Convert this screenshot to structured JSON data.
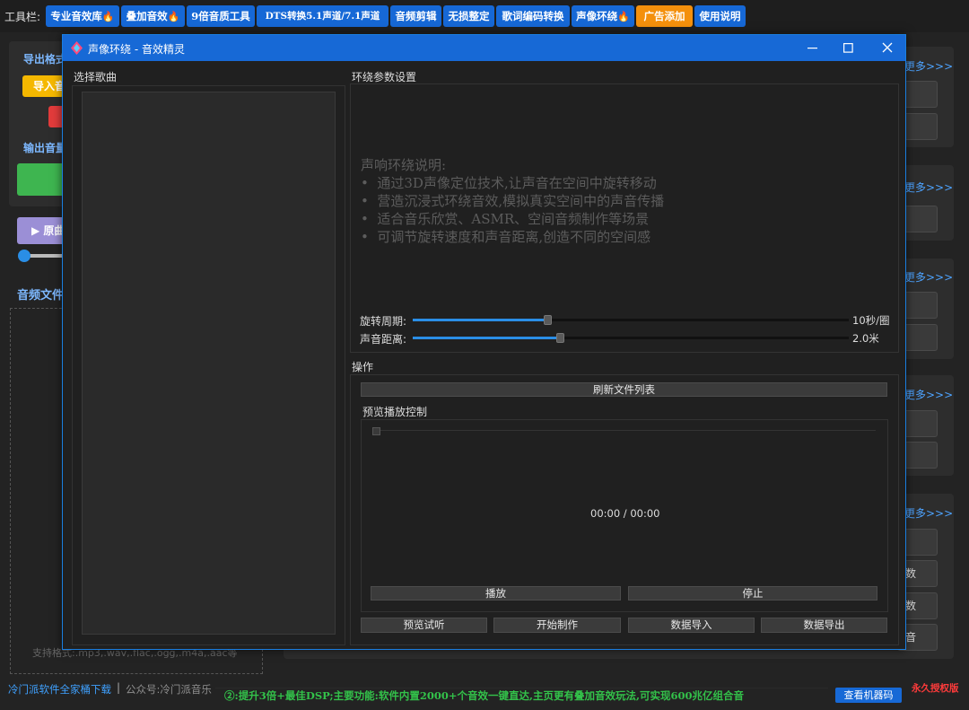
{
  "toolbar": {
    "label": "工具栏:",
    "buttons": [
      {
        "label": "专业音效库",
        "fire": true,
        "style": "blue"
      },
      {
        "label": "叠加音效",
        "fire": true,
        "style": "blue"
      },
      {
        "label": "9倍音质工具",
        "fire": false,
        "style": "blue"
      },
      {
        "label": "DTS转换5.1声道/7.1声道",
        "fire": false,
        "style": "blue"
      },
      {
        "label": "音频剪辑",
        "fire": false,
        "style": "blue"
      },
      {
        "label": "无损整定",
        "fire": false,
        "style": "blue"
      },
      {
        "label": "歌词编码转换",
        "fire": false,
        "style": "blue"
      },
      {
        "label": "声像环绕",
        "fire": true,
        "style": "blue"
      },
      {
        "label": "广告添加",
        "fire": false,
        "style": "orange"
      },
      {
        "label": "使用说明",
        "fire": false,
        "style": "blue"
      }
    ]
  },
  "background": {
    "export_format_label": "导出格式",
    "import_label": "导入音",
    "output_label": "输出音量",
    "play_label": "▶ 原曲",
    "audio_files_label": "音频文件",
    "support_formats": "支持格式:.mp3,.wav,.flac,.ogg,.m4a,.aac等",
    "more_labels": [
      "更多>>>",
      "更多>>>",
      "更多>>>",
      "更多>>>",
      "更多>>>"
    ],
    "right_btn_fragments": [
      "数",
      "数",
      "音"
    ]
  },
  "dialog": {
    "title": "声像环绕 - 音效精灵",
    "select_song_label": "选择歌曲",
    "env_settings_label": "环绕参数设置",
    "desc_title": "声响环绕说明:",
    "desc_items": [
      "通过3D声像定位技术,让声音在空间中旋转移动",
      "营造沉浸式环绕音效,模拟真实空间中的声音传播",
      "适合音乐欣赏、ASMR、空间音频制作等场景",
      "可调节旋转速度和声音距离,创造不同的空间感"
    ],
    "rotation_label": "旋转周期:",
    "rotation_value": "10秒/圈",
    "rotation_level": 0.31,
    "distance_label": "声音距离:",
    "distance_value": "2.0米",
    "distance_level": 0.34,
    "ops_label": "操作",
    "refresh_label": "刷新文件列表",
    "preview_group_label": "预览播放控制",
    "time_display": "00:00 / 00:00",
    "play_label": "播放",
    "stop_label": "停止",
    "preview_label": "预览试听",
    "start_label": "开始制作",
    "import_label": "数据导入",
    "export_label": "数据导出"
  },
  "footer": {
    "download_link": "冷门派软件全家桶下载",
    "separator": "|",
    "wechat": "公众号:冷门派音乐",
    "ticker": "②:提升3倍+最佳DSP;主要功能:软件内置2000+个音效一键直达,主页更有叠加音效玩法,可实现600兆亿组合音",
    "machine_code_btn": "查看机器码",
    "license": "永久授权版"
  },
  "colors": {
    "accent": "#1769d6",
    "orange": "#f4900c",
    "ticker": "#33c24a",
    "license": "#ff3b3b"
  }
}
